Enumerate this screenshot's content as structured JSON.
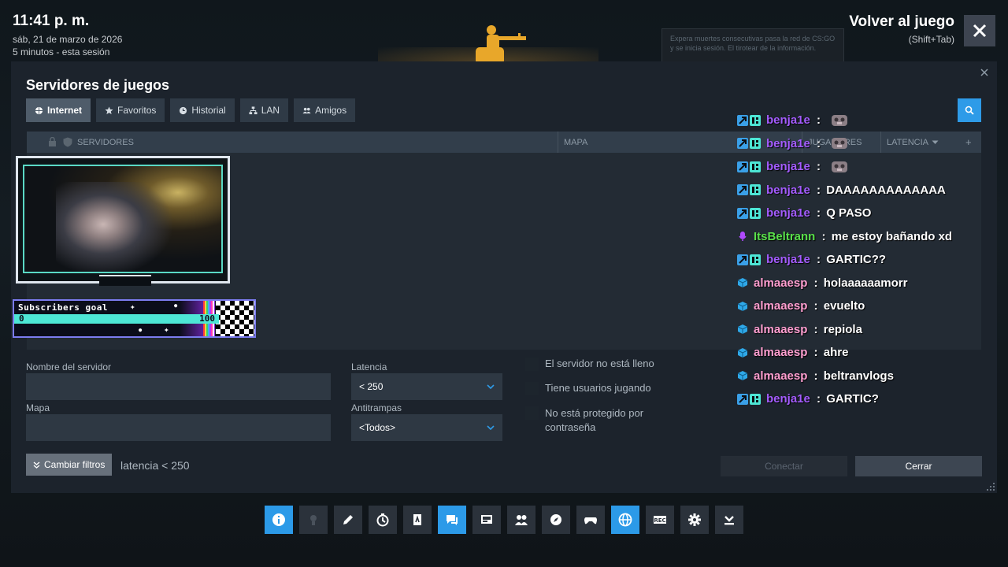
{
  "overlay": {
    "time": "11:41 p. m.",
    "date": "sáb, 21 de marzo de 2026",
    "session": "5 minutos - esta sesión",
    "back_label": "Volver al juego",
    "back_shortcut": "(Shift+Tab)",
    "background_tooltip": "Expera muertes consecutivas pasa la red de CS:GO y se inicia sesión. El tirotear de la información."
  },
  "window": {
    "title": "Servidores de juegos",
    "tabs": [
      {
        "label": "Internet",
        "icon": "globe-icon",
        "active": true
      },
      {
        "label": "Favoritos",
        "icon": "star-icon",
        "active": false
      },
      {
        "label": "Historial",
        "icon": "clock-icon",
        "active": false
      },
      {
        "label": "LAN",
        "icon": "network-icon",
        "active": false
      },
      {
        "label": "Amigos",
        "icon": "friends-icon",
        "active": false
      }
    ],
    "columns": {
      "servers": "SERVIDORES",
      "map": "MAPA",
      "players": "JUGADORES",
      "latency": "LATENCIA",
      "add": "+"
    },
    "filters": {
      "server_name_label": "Nombre del servidor",
      "map_label": "Mapa",
      "latency_label": "Latencia",
      "latency_value": "< 250",
      "anticheat_label": "Antitrampas",
      "anticheat_value": "<Todos>",
      "check_not_full": "El servidor no está lleno",
      "check_has_users": "Tiene usuarios jugando",
      "check_no_password": "No está protegido por contraseña"
    },
    "change_filters": "Cambiar filtros",
    "filter_summary": "latencia < 250",
    "connect": "Conectar",
    "close": "Cerrar"
  },
  "stream_overlay": {
    "goal_title": "Subscribers goal",
    "goal_min": "0",
    "goal_max": "100",
    "goal_progress": 0
  },
  "chat": [
    {
      "user": "benja1e",
      "color": "#a45cff",
      "badges": [
        "prime",
        "gift"
      ],
      "text": "",
      "emote": true
    },
    {
      "user": "benja1e",
      "color": "#a45cff",
      "badges": [
        "prime",
        "gift"
      ],
      "text": "",
      "emote": true
    },
    {
      "user": "benja1e",
      "color": "#a45cff",
      "badges": [
        "prime",
        "gift"
      ],
      "text": "",
      "emote": true
    },
    {
      "user": "benja1e",
      "color": "#a45cff",
      "badges": [
        "prime",
        "gift"
      ],
      "text": "DAAAAAAAAAAAAA",
      "emote": false
    },
    {
      "user": "benja1e",
      "color": "#a45cff",
      "badges": [
        "prime",
        "gift"
      ],
      "text": "Q PASO",
      "emote": false
    },
    {
      "user": "ItsBeltrann",
      "color": "#59e04a",
      "badges": [
        "mic"
      ],
      "text": "me estoy bañando xd",
      "emote": false
    },
    {
      "user": "benja1e",
      "color": "#a45cff",
      "badges": [
        "prime",
        "gift"
      ],
      "text": "GARTIC??",
      "emote": false
    },
    {
      "user": "almaaesp",
      "color": "#ff9ed0",
      "badges": [
        "cube"
      ],
      "text": "holaaaaaamorr",
      "emote": false
    },
    {
      "user": "almaaesp",
      "color": "#ff9ed0",
      "badges": [
        "cube"
      ],
      "text": "evuelto",
      "emote": false
    },
    {
      "user": "almaaesp",
      "color": "#ff9ed0",
      "badges": [
        "cube"
      ],
      "text": "repiola",
      "emote": false
    },
    {
      "user": "almaaesp",
      "color": "#ff9ed0",
      "badges": [
        "cube"
      ],
      "text": "ahre",
      "emote": false
    },
    {
      "user": "almaaesp",
      "color": "#ff9ed0",
      "badges": [
        "cube"
      ],
      "text": "beltranvlogs",
      "emote": false
    },
    {
      "user": "benja1e",
      "color": "#a45cff",
      "badges": [
        "prime",
        "gift"
      ],
      "text": "GARTIC?",
      "emote": false
    }
  ],
  "taskbar": [
    {
      "icon": "info-icon",
      "active": true
    },
    {
      "icon": "achievements-icon",
      "active": false
    },
    {
      "icon": "pencil-icon",
      "active": false
    },
    {
      "icon": "timer-icon",
      "active": false
    },
    {
      "icon": "guide-icon",
      "active": false
    },
    {
      "icon": "chat-icon",
      "active": true
    },
    {
      "icon": "screenshots-icon",
      "active": false
    },
    {
      "icon": "friends-icon",
      "active": false
    },
    {
      "icon": "browser-icon",
      "active": false
    },
    {
      "icon": "controller-icon",
      "active": false
    },
    {
      "icon": "servers-icon",
      "active": true
    },
    {
      "icon": "rec-icon",
      "active": false
    },
    {
      "icon": "settings-icon",
      "active": false
    },
    {
      "icon": "download-icon",
      "active": false
    }
  ],
  "colors": {
    "accent": "#2e9be8",
    "window_bg": "#1c232c",
    "chat_purple": "#a45cff",
    "chat_green": "#59e04a",
    "chat_pink": "#ff9ed0"
  }
}
